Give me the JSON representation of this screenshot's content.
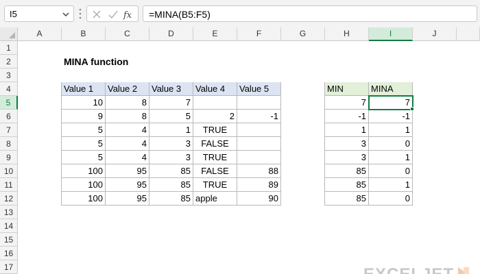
{
  "formula_bar": {
    "name_box": "I5",
    "formula": "=MINA(B5:F5)"
  },
  "columns": [
    "A",
    "B",
    "C",
    "D",
    "E",
    "F",
    "G",
    "H",
    "I",
    "J"
  ],
  "rows": [
    "1",
    "2",
    "3",
    "4",
    "5",
    "6",
    "7",
    "8",
    "9",
    "10",
    "11",
    "12",
    "13",
    "14",
    "15",
    "16",
    "17"
  ],
  "active": {
    "column": "I",
    "row": "5"
  },
  "sheet": {
    "title": "MINA function",
    "headers": [
      "Value 1",
      "Value 2",
      "Value 3",
      "Value 4",
      "Value 5"
    ],
    "data": [
      [
        "10",
        "8",
        "7",
        "",
        ""
      ],
      [
        "9",
        "8",
        "5",
        "2",
        "-1"
      ],
      [
        "5",
        "4",
        "1",
        "TRUE",
        ""
      ],
      [
        "5",
        "4",
        "3",
        "FALSE",
        ""
      ],
      [
        "5",
        "4",
        "3",
        "TRUE",
        ""
      ],
      [
        "100",
        "95",
        "85",
        "FALSE",
        "88"
      ],
      [
        "100",
        "95",
        "85",
        "TRUE",
        "89"
      ],
      [
        "100",
        "95",
        "85",
        "apple",
        "90"
      ]
    ],
    "result_headers": [
      "MIN",
      "MINA"
    ],
    "results": [
      [
        "7",
        "7"
      ],
      [
        "-1",
        "-1"
      ],
      [
        "1",
        "1"
      ],
      [
        "3",
        "0"
      ],
      [
        "3",
        "1"
      ],
      [
        "85",
        "0"
      ],
      [
        "85",
        "1"
      ],
      [
        "85",
        "0"
      ]
    ]
  },
  "logo": {
    "text": "EXCELJET"
  },
  "colors": {
    "accent": "#107c41",
    "table_header": "#dce3f2",
    "result_header": "#e2efd9"
  }
}
